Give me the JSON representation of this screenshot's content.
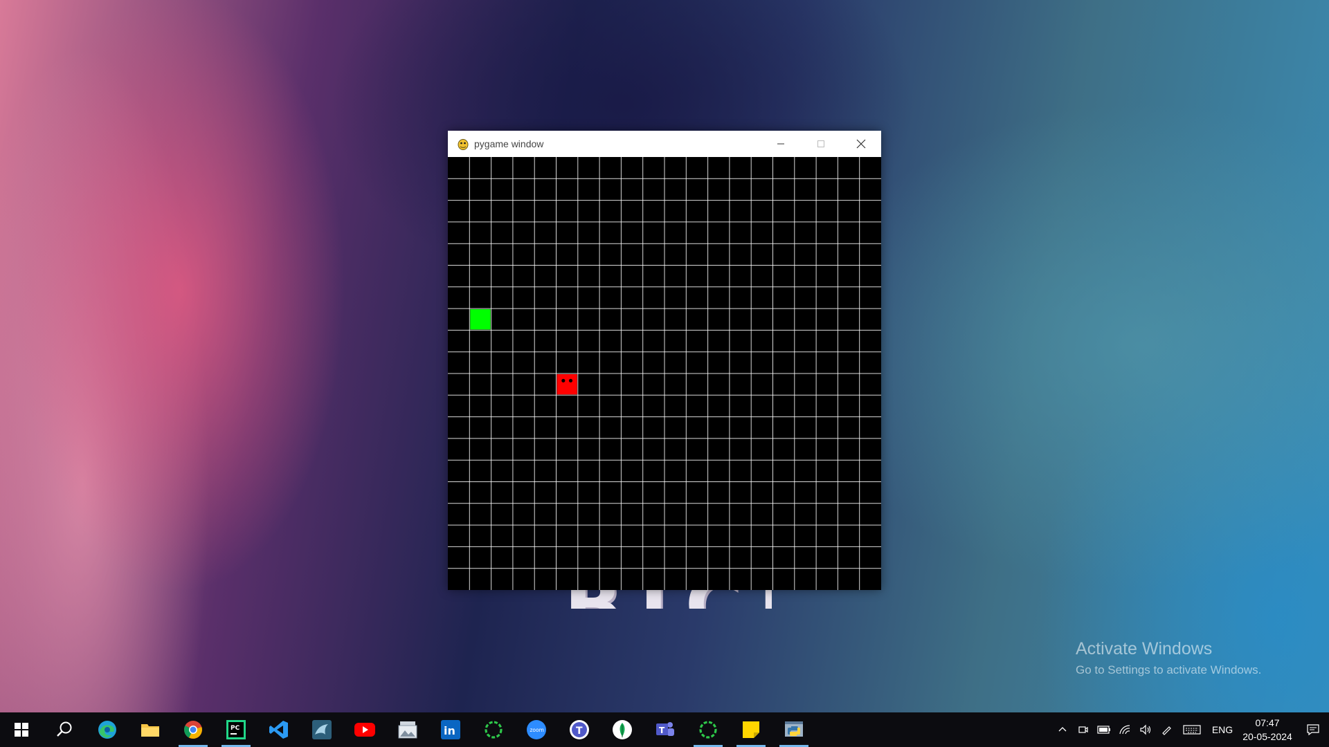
{
  "desktop": {
    "background_text": "BTCT",
    "activate_title": "Activate Windows",
    "activate_subtitle": "Go to Settings to activate Windows."
  },
  "window": {
    "title": "pygame window",
    "icon": "pygame-snake-icon",
    "controls": [
      "minimize",
      "maximize",
      "close"
    ]
  },
  "game": {
    "grid_columns": 20,
    "grid_rows": 20,
    "background_color": "#000000",
    "grid_line_color": "#ffffff",
    "snake": {
      "color": "#00ff00",
      "cells": [
        {
          "col": 1,
          "row": 7
        }
      ]
    },
    "food": {
      "color": "#ff0000",
      "col": 5,
      "row": 10
    }
  },
  "taskbar": {
    "apps": [
      {
        "name": "start",
        "icon": "windows-icon",
        "active": false
      },
      {
        "name": "search",
        "icon": "search-icon",
        "active": false
      },
      {
        "name": "edge",
        "icon": "edge-icon",
        "active": false
      },
      {
        "name": "file-explorer",
        "icon": "folder-icon",
        "active": false
      },
      {
        "name": "chrome",
        "icon": "chrome-icon",
        "active": true
      },
      {
        "name": "pycharm",
        "icon": "pycharm-icon",
        "active": true
      },
      {
        "name": "vscode",
        "icon": "vscode-icon",
        "active": false
      },
      {
        "name": "mysql-workbench",
        "icon": "dolphin-icon",
        "active": false
      },
      {
        "name": "youtube",
        "icon": "youtube-icon",
        "active": false
      },
      {
        "name": "photos",
        "icon": "photos-icon",
        "active": false
      },
      {
        "name": "linkedin",
        "icon": "linkedin-icon",
        "active": false
      },
      {
        "name": "loader-app",
        "icon": "ring-icon",
        "active": false
      },
      {
        "name": "zoom",
        "icon": "zoom-icon",
        "active": false
      },
      {
        "name": "teams-classic",
        "icon": "teams-round-icon",
        "active": false
      },
      {
        "name": "mongodb-compass",
        "icon": "leaf-icon",
        "active": false
      },
      {
        "name": "teams",
        "icon": "teams-icon",
        "active": false
      },
      {
        "name": "loader-app-2",
        "icon": "ring-icon",
        "active": true
      },
      {
        "name": "sticky-notes",
        "icon": "sticky-notes-icon",
        "active": true
      },
      {
        "name": "python-pygame",
        "icon": "python-icon",
        "active": true
      }
    ],
    "zoom_label": "zoom",
    "tray": {
      "language": "ENG",
      "time": "07:47",
      "date": "20-05-2024"
    }
  }
}
